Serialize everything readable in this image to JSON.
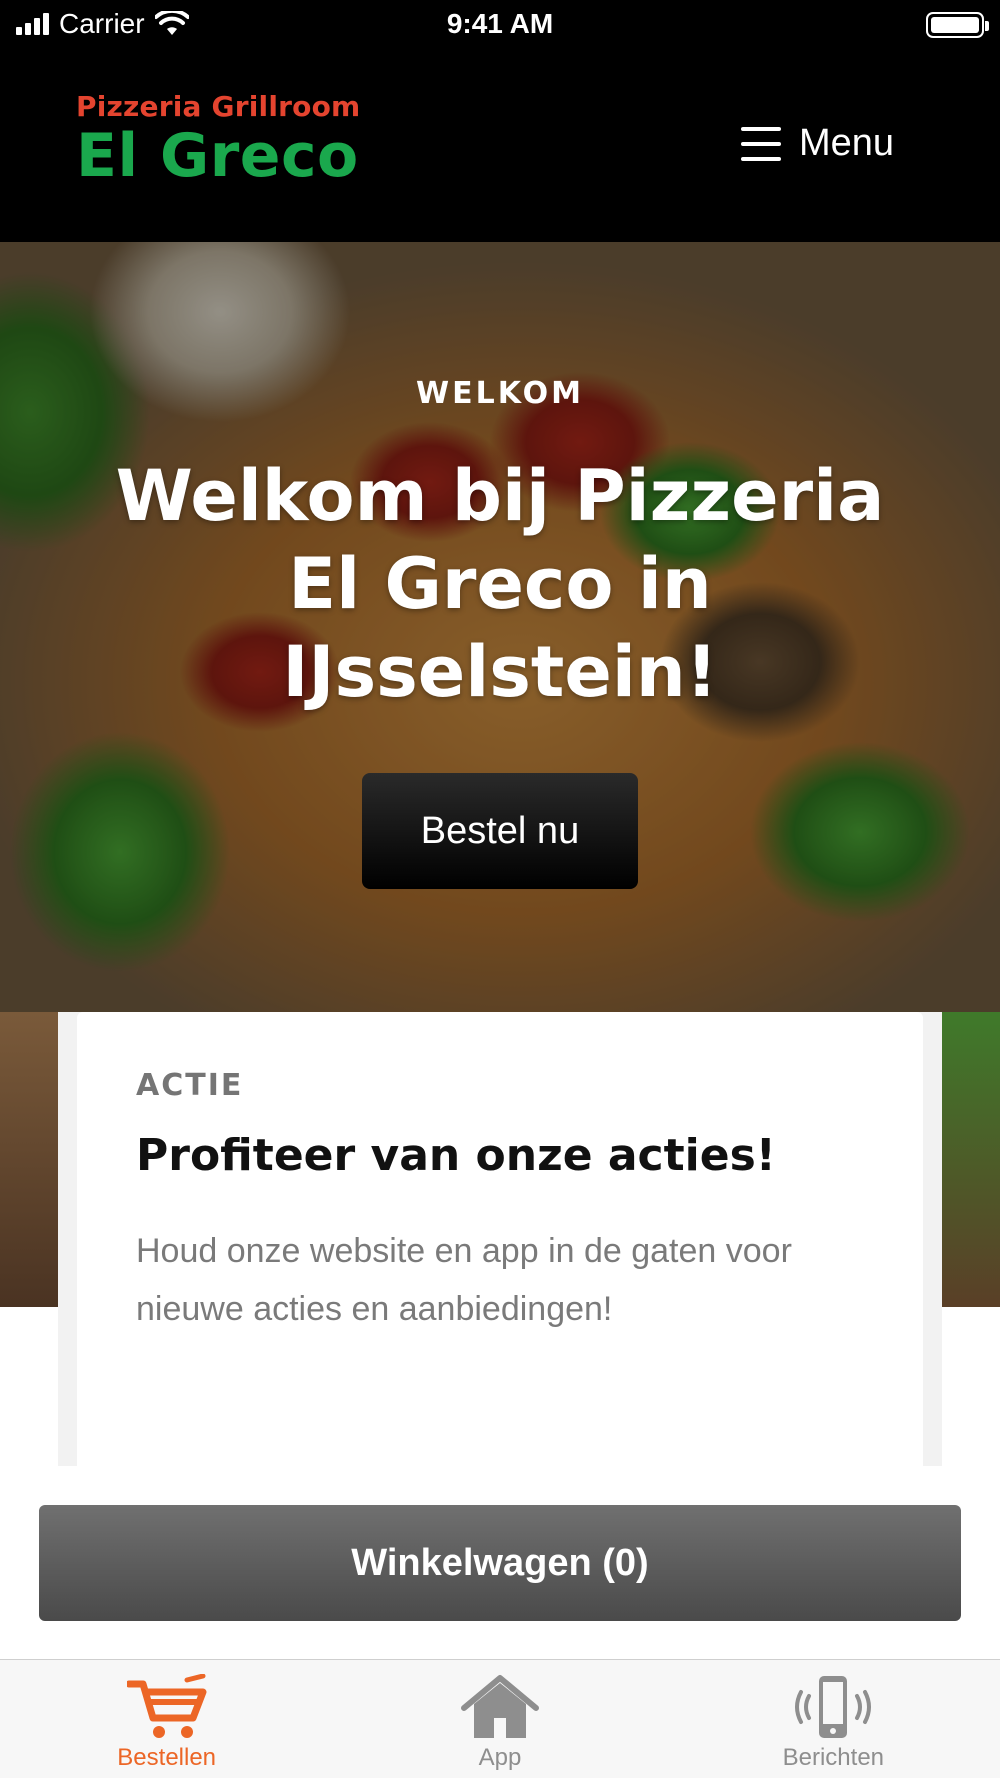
{
  "status_bar": {
    "carrier": "Carrier",
    "time": "9:41 AM"
  },
  "header": {
    "logo_top": "Pizzeria Grillroom",
    "logo_main": "El Greco",
    "menu_label": "Menu"
  },
  "hero": {
    "eyebrow": "WELKOM",
    "title": "Welkom bij Pizzeria El Greco in IJsselstein!",
    "button_label": "Bestel nu"
  },
  "card": {
    "eyebrow": "ACTIE",
    "title": "Profiteer van onze acties!",
    "text": "Houd onze website en app in de gaten voor nieuwe acties en aanbiedingen!"
  },
  "cart": {
    "label": "Winkelwagen (0)"
  },
  "tabs": [
    {
      "label": "Bestellen",
      "icon": "cart-icon",
      "active": true
    },
    {
      "label": "App",
      "icon": "home-icon",
      "active": false
    },
    {
      "label": "Berichten",
      "icon": "phone-vibrate-icon",
      "active": false
    }
  ],
  "colors": {
    "accent": "#ec6626",
    "logo_red": "#e4442f",
    "logo_green": "#1aa84d",
    "inactive_tab": "#8e8e8e"
  }
}
